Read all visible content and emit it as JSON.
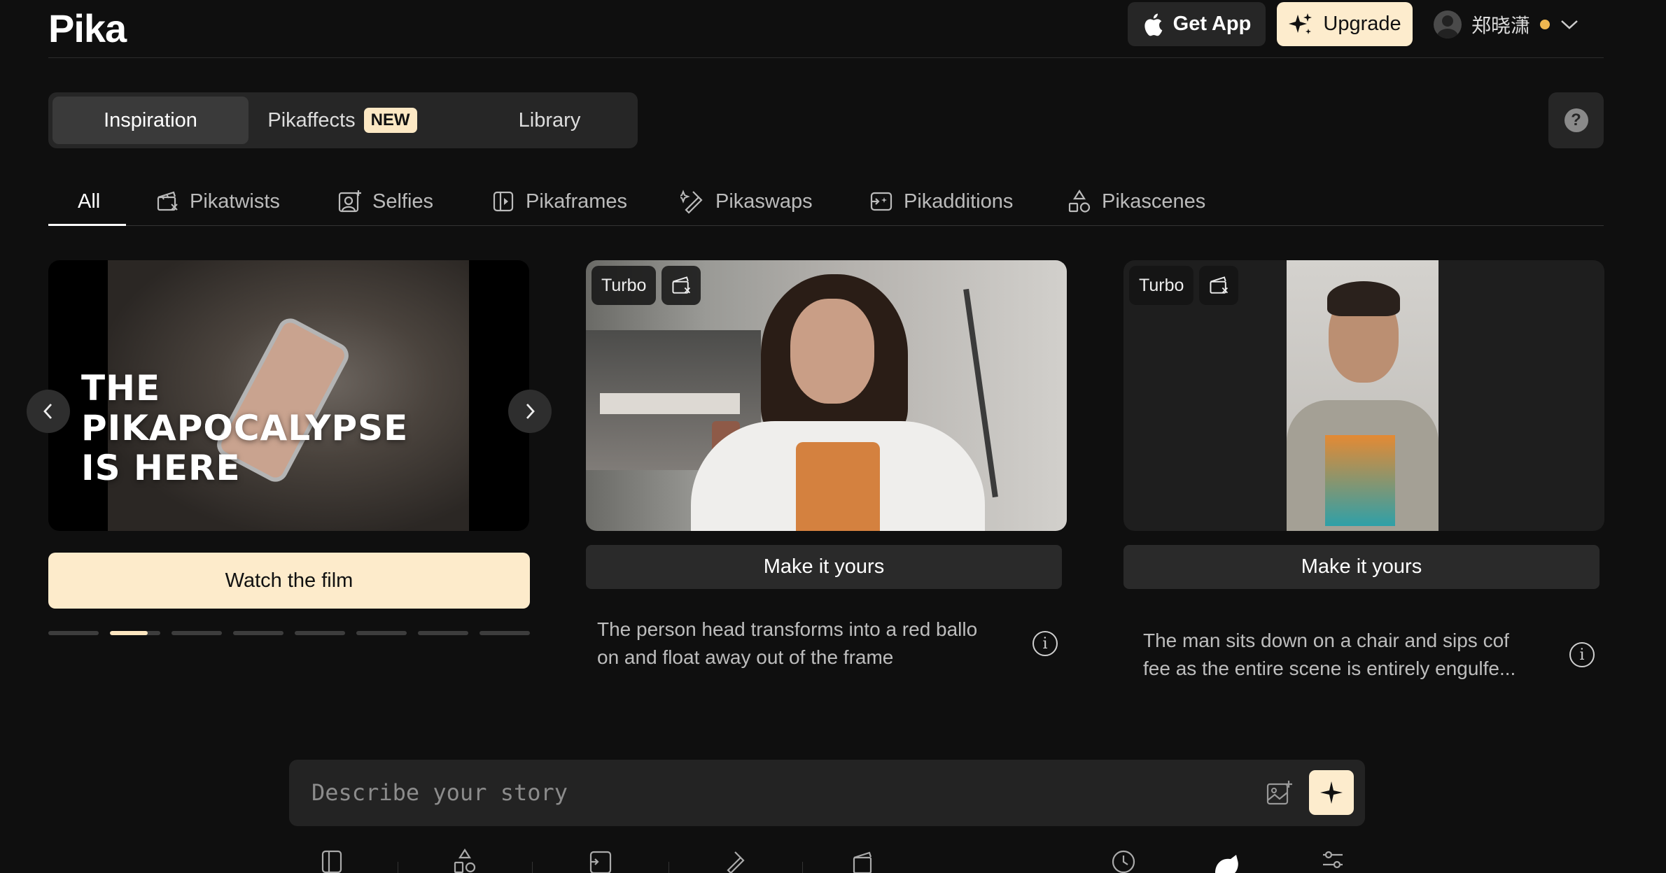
{
  "header": {
    "logo": "Pika",
    "get_app_label": "Get App",
    "upgrade_label": "Upgrade",
    "username": "郑晓潇"
  },
  "tabs": [
    {
      "label": "Inspiration",
      "active": true
    },
    {
      "label": "Pikaffects",
      "badge": "NEW"
    },
    {
      "label": "Library"
    }
  ],
  "categories": [
    {
      "label": "All",
      "icon": "none",
      "active": true
    },
    {
      "label": "Pikatwists",
      "icon": "clapper-icon"
    },
    {
      "label": "Selfies",
      "icon": "selfie-icon"
    },
    {
      "label": "Pikaframes",
      "icon": "frames-icon"
    },
    {
      "label": "Pikaswaps",
      "icon": "swap-icon"
    },
    {
      "label": "Pikadditions",
      "icon": "additions-icon"
    },
    {
      "label": "Pikascenes",
      "icon": "shapes-icon"
    }
  ],
  "hero": {
    "title_line1": "THE",
    "title_line2": "PIKAPOCALYPSE",
    "title_line3": "IS HERE",
    "cta": "Watch the film",
    "carousel_count": 8,
    "carousel_active": 1,
    "carousel_active_fill": 0.75
  },
  "cards": [
    {
      "badge": "Turbo",
      "button": "Make it yours",
      "description_line1": "The person head transforms into a red ballo",
      "description_line2": "on and float away out of the frame"
    },
    {
      "badge": "Turbo",
      "button": "Make it yours",
      "description_line1": "The man sits down on a chair and sips cof",
      "description_line2": "fee as the entire scene is entirely engulfe..."
    }
  ],
  "prompt": {
    "placeholder": "Describe your story"
  },
  "colors": {
    "background": "#0f0f0f",
    "accent": "#fdeccd",
    "panel": "#262626"
  }
}
